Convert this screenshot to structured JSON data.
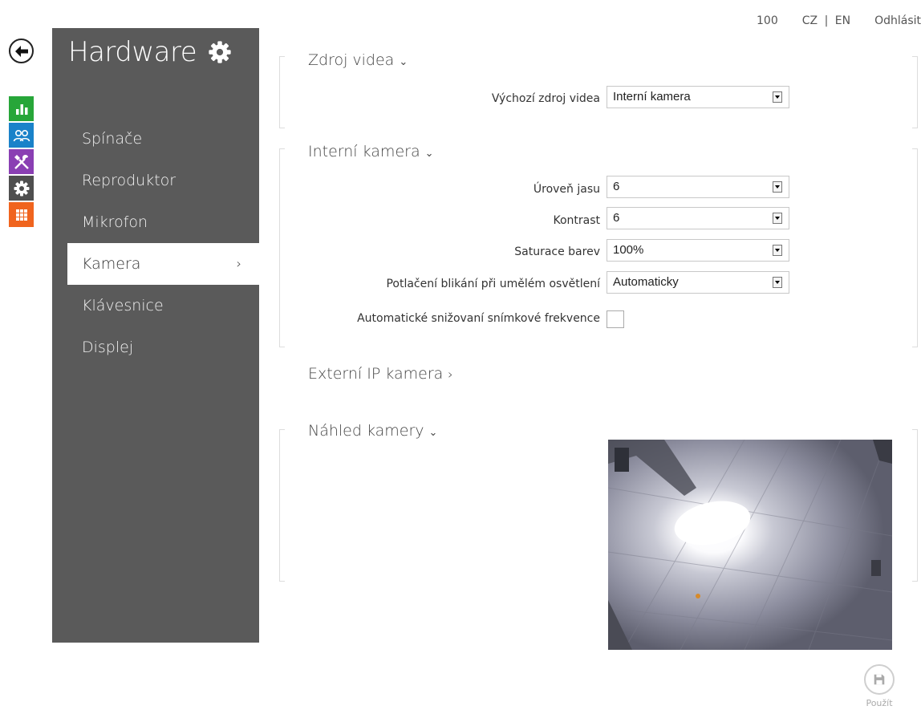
{
  "topbar": {
    "user": "100",
    "lang_cz": "CZ",
    "lang_sep": "|",
    "lang_en": "EN",
    "logout": "Odhlásit"
  },
  "sidebar": {
    "title": "Hardware",
    "items": [
      {
        "label": "Spínače"
      },
      {
        "label": "Reproduktor"
      },
      {
        "label": "Mikrofon"
      },
      {
        "label": "Kamera",
        "active": true
      },
      {
        "label": "Klávesnice"
      },
      {
        "label": "Displej"
      }
    ]
  },
  "rail": [
    {
      "icon": "stats-icon",
      "color": "#27a639"
    },
    {
      "icon": "users-icon",
      "color": "#1a82c9"
    },
    {
      "icon": "tools-icon",
      "color": "#8a3fb3"
    },
    {
      "icon": "gear-icon",
      "color": "#4f4f4f"
    },
    {
      "icon": "grid-icon",
      "color": "#f0641e"
    }
  ],
  "sections": {
    "video_source": {
      "title": "Zdroj videa",
      "default_source_label": "Výchozí zdroj videa",
      "default_source_value": "Interní kamera"
    },
    "internal_camera": {
      "title": "Interní kamera",
      "brightness_label": "Úroveň jasu",
      "brightness_value": "6",
      "contrast_label": "Kontrast",
      "contrast_value": "6",
      "saturation_label": "Saturace barev",
      "saturation_value": "100%",
      "flicker_label": "Potlačení blikání při umělém osvětlení",
      "flicker_value": "Automaticky",
      "auto_fps_label": "Automatické snižovaní snímkové frekvence",
      "auto_fps_checked": false
    },
    "external_camera": {
      "title": "Externí IP kamera"
    },
    "preview": {
      "title": "Náhled kamery"
    }
  },
  "apply": {
    "label": "Použít"
  },
  "colors": {
    "sidebar_bg": "#5a5a5a",
    "accent": "#ffffff"
  }
}
